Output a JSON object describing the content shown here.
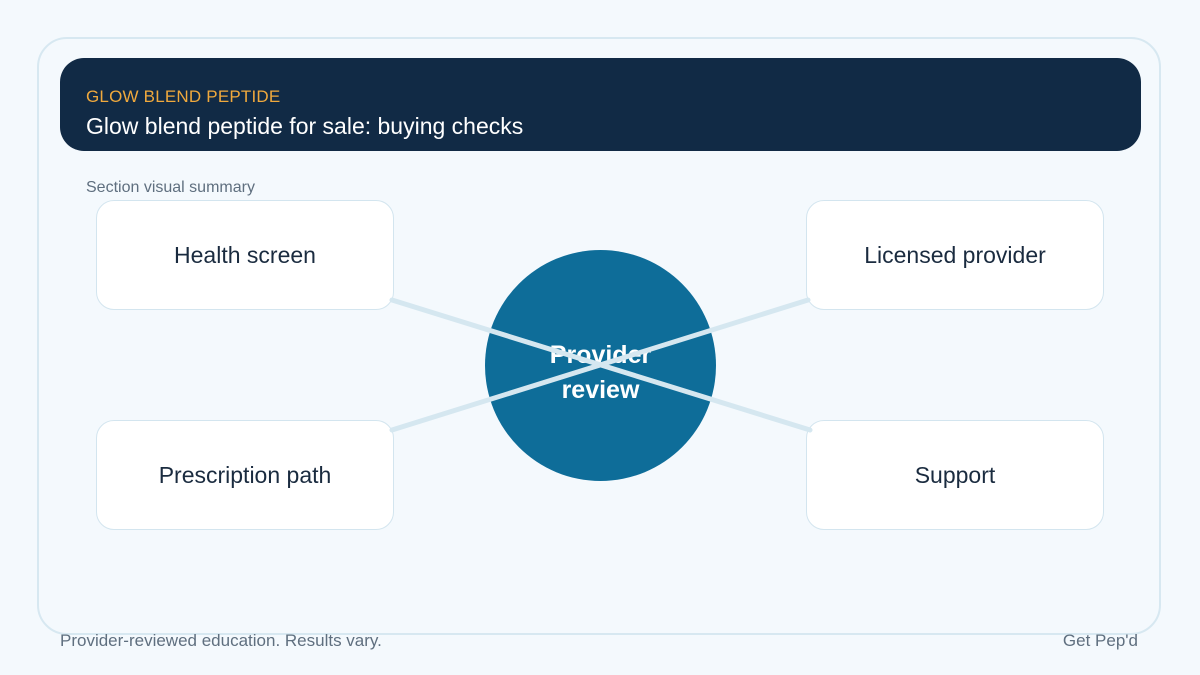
{
  "header": {
    "eyebrow": "GLOW BLEND PEPTIDE",
    "title": "Glow blend peptide for sale: buying checks"
  },
  "section_label": "Section visual summary",
  "diagram": {
    "hub": {
      "label_line1": "Provider",
      "label_line2": "review"
    },
    "nodes": [
      {
        "label": "Health screen"
      },
      {
        "label": "Licensed provider"
      },
      {
        "label": "Prescription path"
      },
      {
        "label": "Support"
      }
    ]
  },
  "footer": {
    "disclaimer": "Provider-reviewed education. Results vary.",
    "brand": "Get Pep'd"
  },
  "colors": {
    "background": "#f4f9fd",
    "header_bg": "#112a45",
    "accent": "#f0a93d",
    "hub": "#0e6d99",
    "connector": "#d5e7f0"
  }
}
